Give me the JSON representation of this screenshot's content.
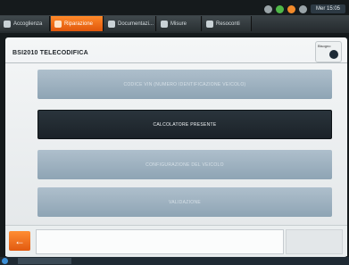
{
  "tabs": [
    {
      "label": "Accoglienza",
      "icon": "home-icon",
      "active": false
    },
    {
      "label": "Riparazione",
      "icon": "wrench-icon",
      "active": true
    },
    {
      "label": "Documentazi...",
      "icon": "document-icon",
      "active": false
    },
    {
      "label": "Misure",
      "icon": "gauge-icon",
      "active": false
    },
    {
      "label": "Resoconti",
      "icon": "report-icon",
      "active": false
    }
  ],
  "status": {
    "clock": "Mer 15:05"
  },
  "page": {
    "title": "BSI2010  TELECODIFICA"
  },
  "help": {
    "label": "Bisogno"
  },
  "options": [
    {
      "label": "Codice VIN (numero identificazione veicolo)",
      "state": "disabled"
    },
    {
      "label": "Calcolatore presente",
      "state": "selected"
    },
    {
      "label": "Configurazione del veicolo",
      "state": "disabled"
    },
    {
      "label": "Validazione",
      "state": "disabled"
    }
  ],
  "colors": {
    "accent": "#f27a1f",
    "panel": "#eef1f2",
    "option_disabled": "#9fb3c2",
    "option_selected": "#222b31"
  }
}
